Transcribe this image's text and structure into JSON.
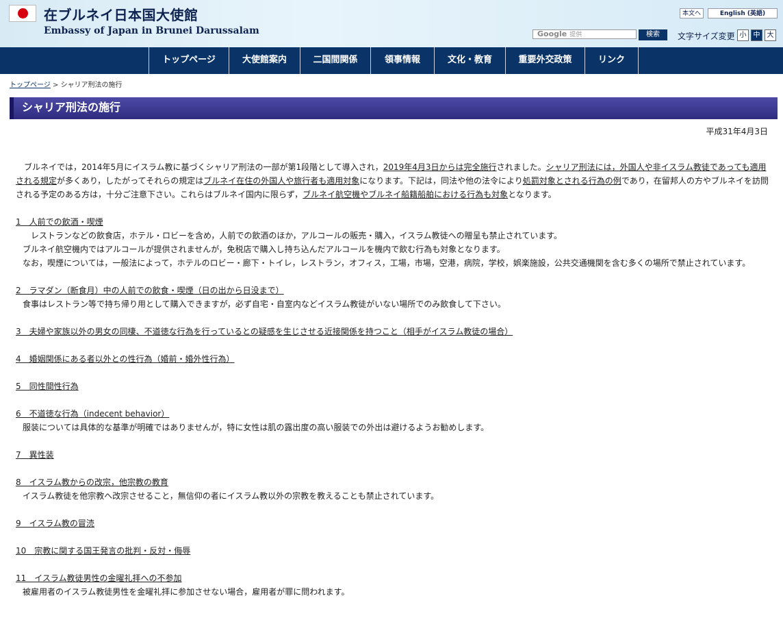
{
  "header": {
    "title_ja": "在ブルネイ日本国大使館",
    "title_en": "Embassy of Japan in Brunei Darussalam",
    "honbun_link": "本文へ",
    "english_link": "English (英語)",
    "search_logo": "Google",
    "search_placeholder": "提供",
    "search_button": "検索",
    "fontsize_label": "文字サイズ変更",
    "fontsize_small": "小",
    "fontsize_medium": "中",
    "fontsize_large": "大"
  },
  "nav": {
    "items": [
      "トップページ",
      "大使館案内",
      "二国間関係",
      "領事情報",
      "文化・教育",
      "重要外交政策",
      "リンク"
    ]
  },
  "breadcrumb": {
    "home": "トップページ",
    "separator": " > ",
    "current": "シャリア刑法の施行"
  },
  "page_title": "シャリア刑法の施行",
  "date": "平成31年4月3日",
  "intro": {
    "t1": "ブルネイでは，2014年5月にイスラム教に基づくシャリア刑法の一部が第1段階として導入され，",
    "u1": "2019年4月3日からは完全施行",
    "t2": "されました。",
    "u2": "シャリア刑法には，外国人や非イスラム教徒であっても適用される規定",
    "t3": "が多くあり，したがってそれらの規定は",
    "u3": "ブルネイ在住の外国人や旅行者も適用対象",
    "t4": "になります。下記は，同法や他の法令により",
    "u4": "処罰対象とされる行為の例",
    "t5": "であり，在留邦人の方やブルネイを訪問される予定のある方は，十分ご注意下さい。これらはブルネイ国内に限らず，",
    "u5": "ブルネイ航空機やブルネイ船籍船舶における行為も対象",
    "t6": "となります。"
  },
  "sections": [
    {
      "head": "1　人前での飲酒・喫煙",
      "lines": [
        "　レストランなどの飲食店，ホテル・ロビーを含め，人前での飲酒のほか，アルコールの販売・購入，イスラム教徒への贈呈も禁止されています。",
        "ブルネイ航空機内ではアルコールが提供されませんが，免税店で購入し持ち込んだアルコールを機内で飲む行為も対象となります。",
        "なお，喫煙については，一般法によって，ホテルのロビー・廊下・トイレ，レストラン，オフィス，工場，市場，空港，病院，学校，娯楽施設，公共交通機関を含む多くの場所で禁止されています。"
      ]
    },
    {
      "head": "2　ラマダン（断食月）中の人前での飲食・喫煙（日の出から日没まで）",
      "lines": [
        "食事はレストラン等で持ち帰り用として購入できますが，必ず自宅・自室内などイスラム教徒がいない場所でのみ飲食して下さい。"
      ]
    },
    {
      "head": "3　夫婦や家族以外の男女の同棲、不道徳な行為を行っているとの疑感を生じさせる近接関係を持つこと（相手がイスラム教徒の場合）",
      "lines": []
    },
    {
      "head": "4　婚姻関係にある者以外との性行為（婚前・婚外性行為）",
      "lines": []
    },
    {
      "head": "5　同性間性行為",
      "lines": []
    },
    {
      "head": "6　不道徳な行為（indecent behavior）",
      "lines": [
        "服装については具体的な基準が明確ではありませんが，特に女性は肌の露出度の高い服装での外出は避けるようお勧めします。"
      ]
    },
    {
      "head": "7　異性装",
      "lines": []
    },
    {
      "head": "8　イスラム教からの改宗，他宗教の教育",
      "lines": [
        "イスラム教徒を他宗教へ改宗させること，無信仰の者にイスラム教以外の宗教を教えることも禁止されています。"
      ]
    },
    {
      "head": "9　イスラム教の冒涜",
      "lines": []
    },
    {
      "head": "10　宗教に関する国王発言の批判・反対・侮辱",
      "lines": []
    },
    {
      "head": "11　イスラム教徒男性の金曜礼拝への不参加",
      "lines": [
        "被雇用者のイスラム教徒男性を金曜礼拝に参加させない場合，雇用者が罪に問われます。"
      ]
    }
  ]
}
